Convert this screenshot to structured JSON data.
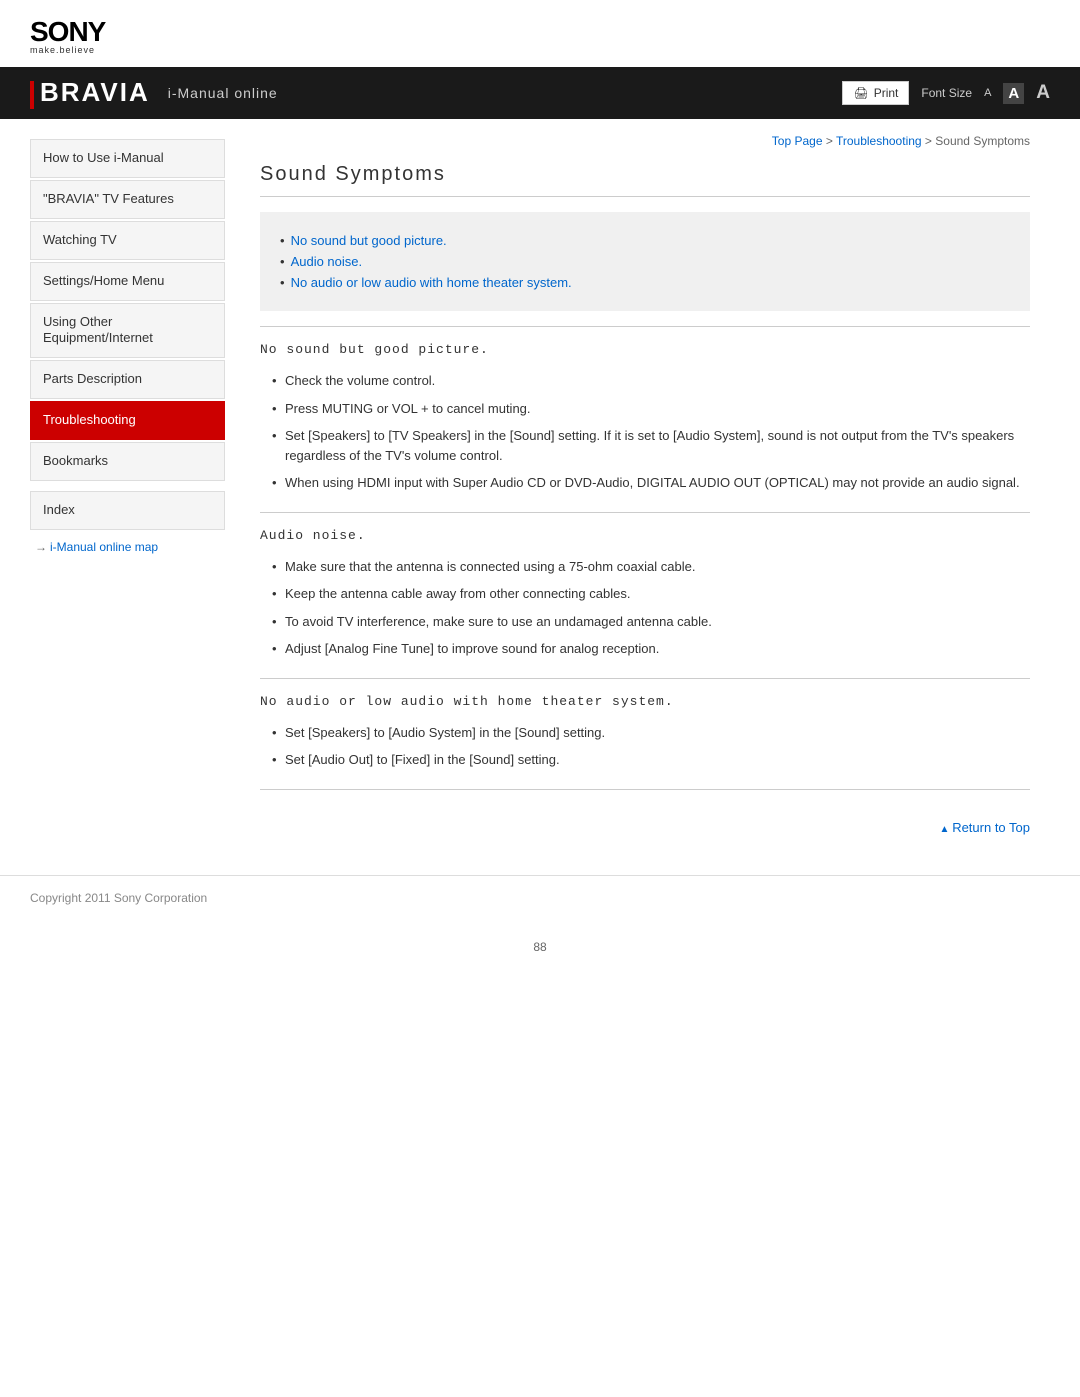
{
  "logo": {
    "sony": "SONY",
    "tagline": "make.believe"
  },
  "header": {
    "bravia": "BRAVIA",
    "imanual": "i-Manual online",
    "print_label": "Print",
    "font_size_label": "Font Size",
    "font_small": "A",
    "font_medium": "A",
    "font_large": "A"
  },
  "breadcrumb": {
    "top_page": "Top Page",
    "separator1": " > ",
    "troubleshooting": "Troubleshooting",
    "separator2": " > ",
    "current": "Sound Symptoms"
  },
  "sidebar": {
    "items": [
      {
        "label": "How to Use i-Manual",
        "active": false
      },
      {
        "label": "\"BRAVIA\" TV Features",
        "active": false
      },
      {
        "label": "Watching TV",
        "active": false
      },
      {
        "label": "Settings/Home Menu",
        "active": false
      },
      {
        "label": "Using Other Equipment/Internet",
        "active": false
      },
      {
        "label": "Parts Description",
        "active": false
      },
      {
        "label": "Troubleshooting",
        "active": true
      },
      {
        "label": "Bookmarks",
        "active": false
      }
    ],
    "index_label": "Index",
    "map_link": "i-Manual online map"
  },
  "content": {
    "page_title": "Sound Symptoms",
    "summary_links": [
      "No sound but good picture.",
      "Audio noise.",
      "No audio or low audio with home theater system."
    ],
    "sections": [
      {
        "title": "No sound but good picture.",
        "items": [
          "Check the volume control.",
          "Press MUTING or VOL + to cancel muting.",
          "Set [Speakers] to [TV Speakers] in the [Sound] setting. If it is set to [Audio System], sound is not output from the TV's speakers regardless of the TV's volume control.",
          "When using HDMI input with Super Audio CD or DVD-Audio, DIGITAL AUDIO OUT (OPTICAL) may not provide an audio signal."
        ]
      },
      {
        "title": "Audio noise.",
        "items": [
          "Make sure that the antenna is connected using a 75-ohm coaxial cable.",
          "Keep the antenna cable away from other connecting cables.",
          "To avoid TV interference, make sure to use an undamaged antenna cable.",
          "Adjust [Analog Fine Tune] to improve sound for analog reception."
        ]
      },
      {
        "title": "No audio or low audio with home theater system.",
        "items": [
          "Set [Speakers] to [Audio System] in the [Sound] setting.",
          "Set [Audio Out] to [Fixed] in the [Sound] setting."
        ]
      }
    ],
    "return_top": "Return to Top"
  },
  "footer": {
    "copyright": "Copyright 2011 Sony Corporation"
  },
  "page_number": "88"
}
